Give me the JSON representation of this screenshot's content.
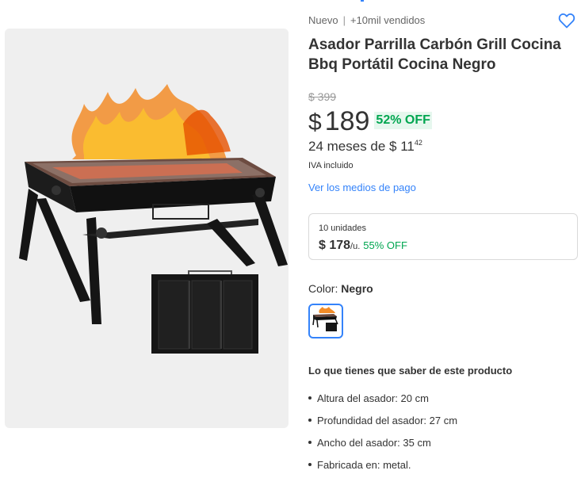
{
  "product": {
    "condition": "Nuevo",
    "sold": "+10mil vendidos",
    "title": "Asador Parrilla Carbón Grill Cocina Bbq Portátil Cocina Negro",
    "original_price": "$ 399",
    "currency": "$",
    "price": "189",
    "discount": "52% OFF",
    "installments_text": "24 meses de $ 11",
    "installments_cents": "42",
    "tax_note": "IVA incluido",
    "payment_link": "Ver los medios de pago"
  },
  "bulk_offer": {
    "units": "10 unidades",
    "price": "$ 178",
    "unit_suffix": "/u.",
    "discount": "55% OFF"
  },
  "color": {
    "label": "Color:",
    "selected": "Negro"
  },
  "features": {
    "title": "Lo que tienes que saber de este producto",
    "items": [
      "Altura del asador: 20 cm",
      "Profundidad del asador: 27 cm",
      "Ancho del asador: 35 cm",
      "Fabricada en: metal."
    ]
  },
  "icons": {
    "favorite": "heart-outline-icon"
  },
  "colors": {
    "accent": "#3483fa",
    "discount_green": "#00a650",
    "discount_bg": "#e6f7ee",
    "text": "#333333",
    "muted": "#999999"
  }
}
